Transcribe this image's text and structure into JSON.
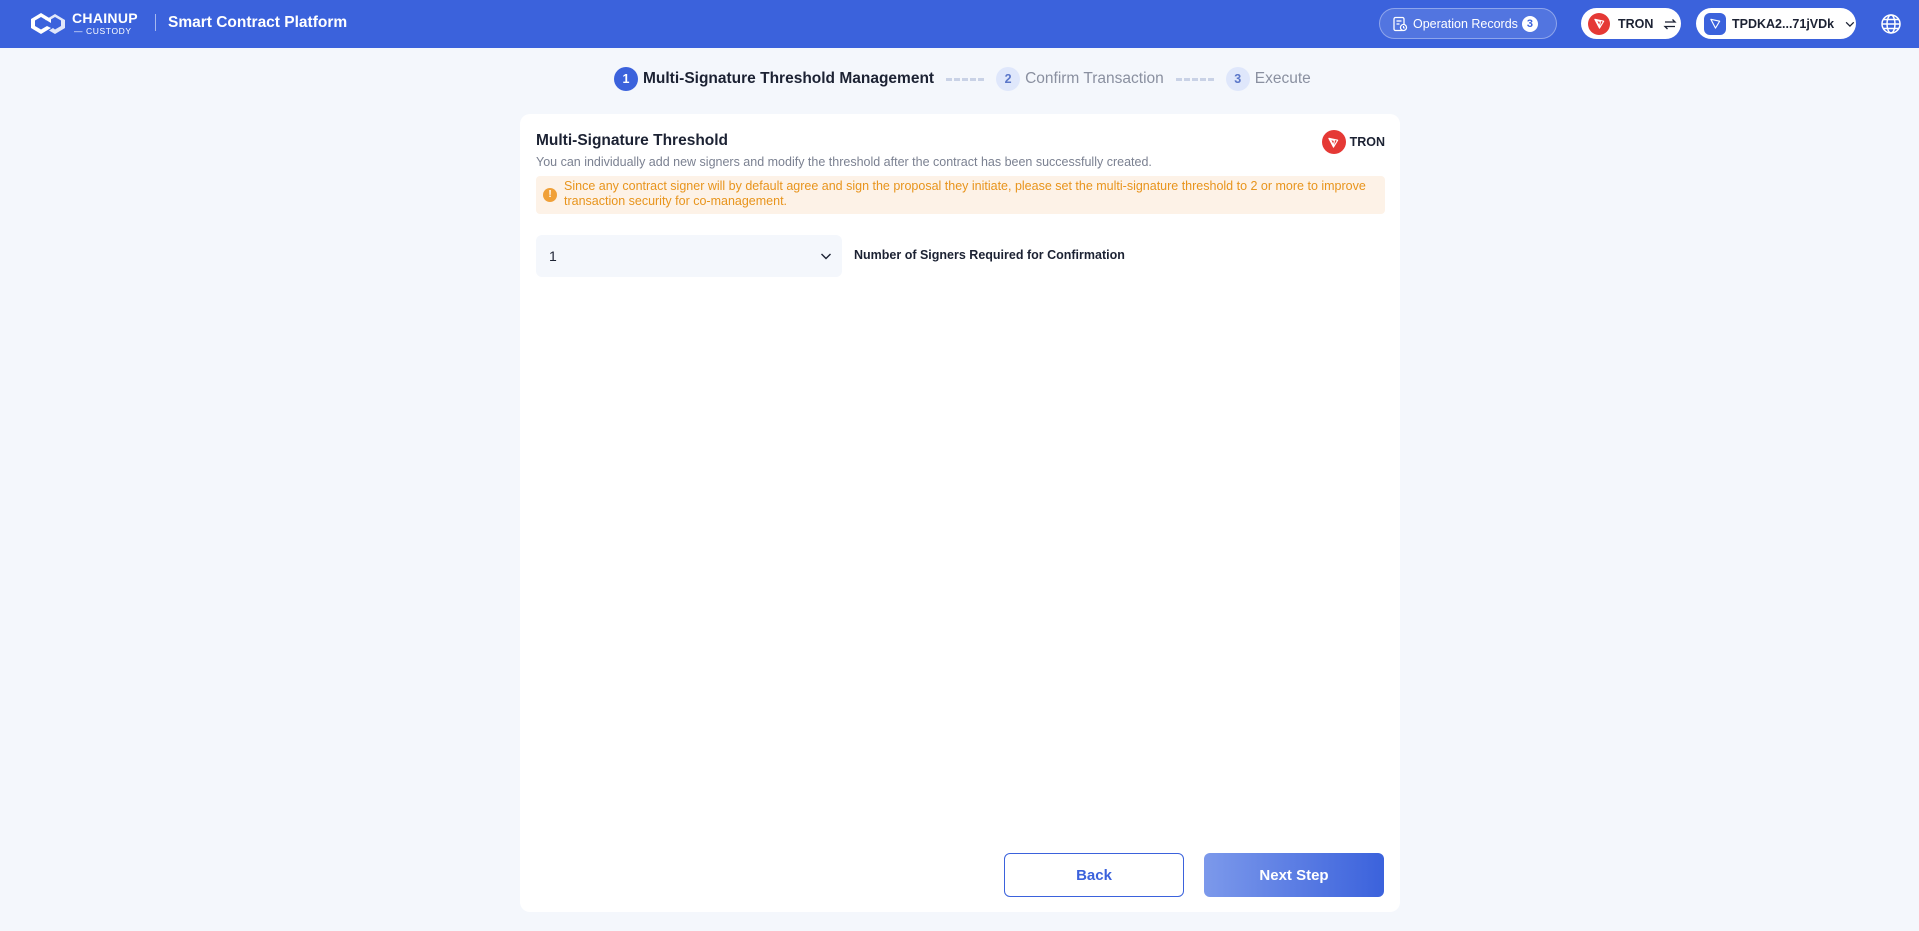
{
  "header": {
    "logo_line1": "CHAINUP",
    "logo_line2": "— CUSTODY",
    "app_title": "Smart Contract Platform",
    "operation_records_label": "Operation Records",
    "operation_records_count": "3",
    "network_label": "TRON",
    "wallet_label": "TPDKA2...71jVDk"
  },
  "stepper": {
    "steps": [
      {
        "num": "1",
        "label": "Multi-Signature Threshold Management",
        "state": "active"
      },
      {
        "num": "2",
        "label": "Confirm Transaction",
        "state": "pending"
      },
      {
        "num": "3",
        "label": "Execute",
        "state": "pending"
      }
    ]
  },
  "card": {
    "title": "Multi-Signature Threshold",
    "description": "You can individually add new signers and modify the threshold after the contract has been successfully created.",
    "network_label": "TRON",
    "warning_icon": "!",
    "warning_text": "Since any contract signer will by default agree and sign the proposal they initiate, please set the multi-signature threshold to 2 or more to improve transaction security for co-management.",
    "threshold_value": "1",
    "threshold_caption": "Number of Signers Required for Confirmation",
    "back_label": "Back",
    "next_label": "Next Step"
  },
  "icons": {
    "logo": "chainup-logo-icon",
    "records": "records-icon",
    "network": "tron-icon",
    "switch": "switch-arrows-icon",
    "wallet": "wallet-icon",
    "chevron": "chevron-down-icon",
    "globe": "globe-icon",
    "warning": "warning-icon"
  },
  "colors": {
    "brand": "#3b62dc",
    "tron": "#e53935",
    "warning_text": "#e8941c",
    "warning_bg": "#fdf2e7",
    "page_bg": "#f4f7fc"
  }
}
